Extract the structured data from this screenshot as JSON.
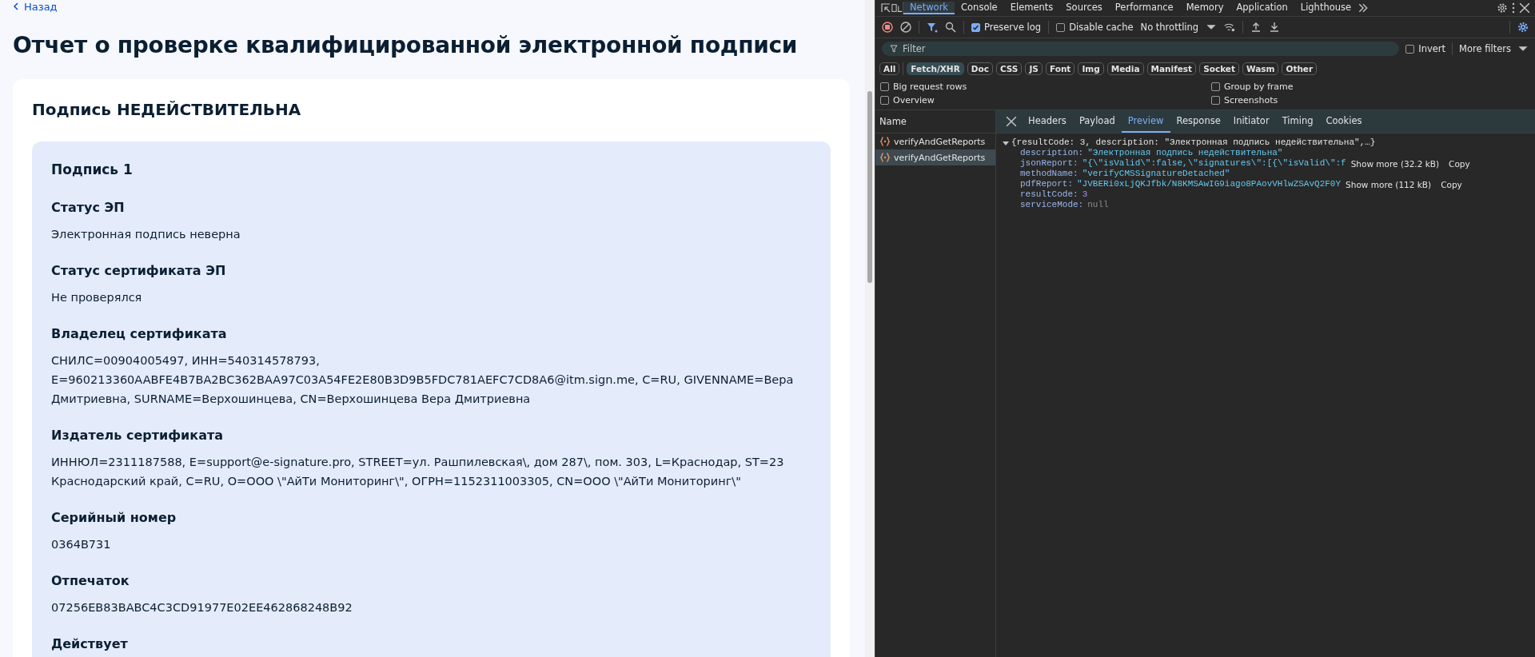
{
  "page": {
    "back_link": "Назад",
    "title": "Отчет о проверке квалифицированной электронной подписи",
    "card": {
      "status_title": "Подпись НЕДЕЙСТВИТЕЛЬНА",
      "signature": {
        "title": "Подпись 1",
        "fields": [
          {
            "label": "Статус ЭП",
            "value": "Электронная подпись неверна"
          },
          {
            "label": "Статус сертификата ЭП",
            "value": "Не проверялся"
          },
          {
            "label": "Владелец сертификата",
            "value": "СНИЛС=00904005497, ИНН=540314578793, E=960213360AABFE4B7BA2BC362BAA97C03A54FE2E80B3D9B5FDC781AEFC7CD8A6@itm.sign.me, C=RU, GIVENNAME=Вера Дмитриевна, SURNAME=Верхошинцева, CN=Верхошинцева Вера Дмитриевна"
          },
          {
            "label": "Издатель сертификата",
            "value": "ИННЮЛ=2311187588, E=support@e-signature.pro, STREET=ул. Рашпилевская\\, дом 287\\, пом. 303, L=Краснодар, ST=23 Краснодарский край, C=RU, O=ООО \\\"АйТи Мониторинг\\\", ОГРН=1152311003305, CN=ООО \\\"АйТи Мониторинг\\\""
          },
          {
            "label": "Серийный номер",
            "value": "0364B731"
          },
          {
            "label": "Отпечаток",
            "value": "07256EB83BABC4C3CD91977E02EE462868248B92"
          },
          {
            "label": "Действует"
          }
        ]
      }
    }
  },
  "devtools": {
    "panel_tabs": [
      {
        "label": "Network",
        "selected": true
      },
      {
        "label": "Console",
        "selected": false
      },
      {
        "label": "Elements",
        "selected": false
      },
      {
        "label": "Sources",
        "selected": false
      },
      {
        "label": "Performance",
        "selected": false
      },
      {
        "label": "Memory",
        "selected": false
      },
      {
        "label": "Application",
        "selected": false
      },
      {
        "label": "Lighthouse",
        "selected": false
      }
    ],
    "toolbar": {
      "preserve_log": {
        "label": "Preserve log",
        "checked": true
      },
      "disable_cache": {
        "label": "Disable cache",
        "checked": false
      },
      "throttling": "No throttling"
    },
    "filter": {
      "placeholder": "Filter",
      "invert": {
        "label": "Invert",
        "checked": false
      },
      "more_filters": "More filters"
    },
    "type_filters": [
      {
        "label": "All",
        "selected": false
      },
      {
        "label": "Fetch/XHR",
        "selected": true
      },
      {
        "label": "Doc",
        "selected": false
      },
      {
        "label": "CSS",
        "selected": false
      },
      {
        "label": "JS",
        "selected": false
      },
      {
        "label": "Font",
        "selected": false
      },
      {
        "label": "Img",
        "selected": false
      },
      {
        "label": "Media",
        "selected": false
      },
      {
        "label": "Manifest",
        "selected": false
      },
      {
        "label": "Socket",
        "selected": false
      },
      {
        "label": "Wasm",
        "selected": false
      },
      {
        "label": "Other",
        "selected": false
      }
    ],
    "options": [
      {
        "label": "Big request rows",
        "checked": false
      },
      {
        "label": "Group by frame",
        "checked": false
      },
      {
        "label": "Overview",
        "checked": false
      },
      {
        "label": "Screenshots",
        "checked": false
      }
    ],
    "requests": {
      "column": "Name",
      "items": [
        {
          "name": "verifyAndGetReports",
          "selected": false
        },
        {
          "name": "verifyAndGetReports",
          "selected": true
        }
      ]
    },
    "detail_tabs": [
      {
        "label": "Headers",
        "selected": false
      },
      {
        "label": "Payload",
        "selected": false
      },
      {
        "label": "Preview",
        "selected": true
      },
      {
        "label": "Response",
        "selected": false
      },
      {
        "label": "Initiator",
        "selected": false
      },
      {
        "label": "Timing",
        "selected": false
      },
      {
        "label": "Cookies",
        "selected": false
      }
    ],
    "preview": {
      "summary": "{resultCode: 3, description: \"Электронная подпись недействительна\",…}",
      "expanded": true,
      "props": [
        {
          "key": "description:",
          "kind": "string",
          "value": "\"Электронная подпись недействительна\""
        },
        {
          "key": "jsonReport:",
          "kind": "string",
          "value": "\"{\\\"isValid\\\":false,\\\"signatures\\\":[{\\\"isValid\\\":f",
          "show_more": "Show more (32.2 kB)",
          "copy": "Copy"
        },
        {
          "key": "methodName:",
          "kind": "string",
          "value": "\"verifyCMSSignatureDetached\""
        },
        {
          "key": "pdfReport:",
          "kind": "string",
          "value": "\"JVBERi0xLjQKJfbk/N8KMSAwIG9iago8PAovVHlwZSAvQ2F0Y",
          "show_more": "Show more (112 kB)",
          "copy": "Copy"
        },
        {
          "key": "resultCode:",
          "kind": "number",
          "value": "3"
        },
        {
          "key": "serviceMode:",
          "kind": "null",
          "value": "null"
        }
      ]
    }
  }
}
